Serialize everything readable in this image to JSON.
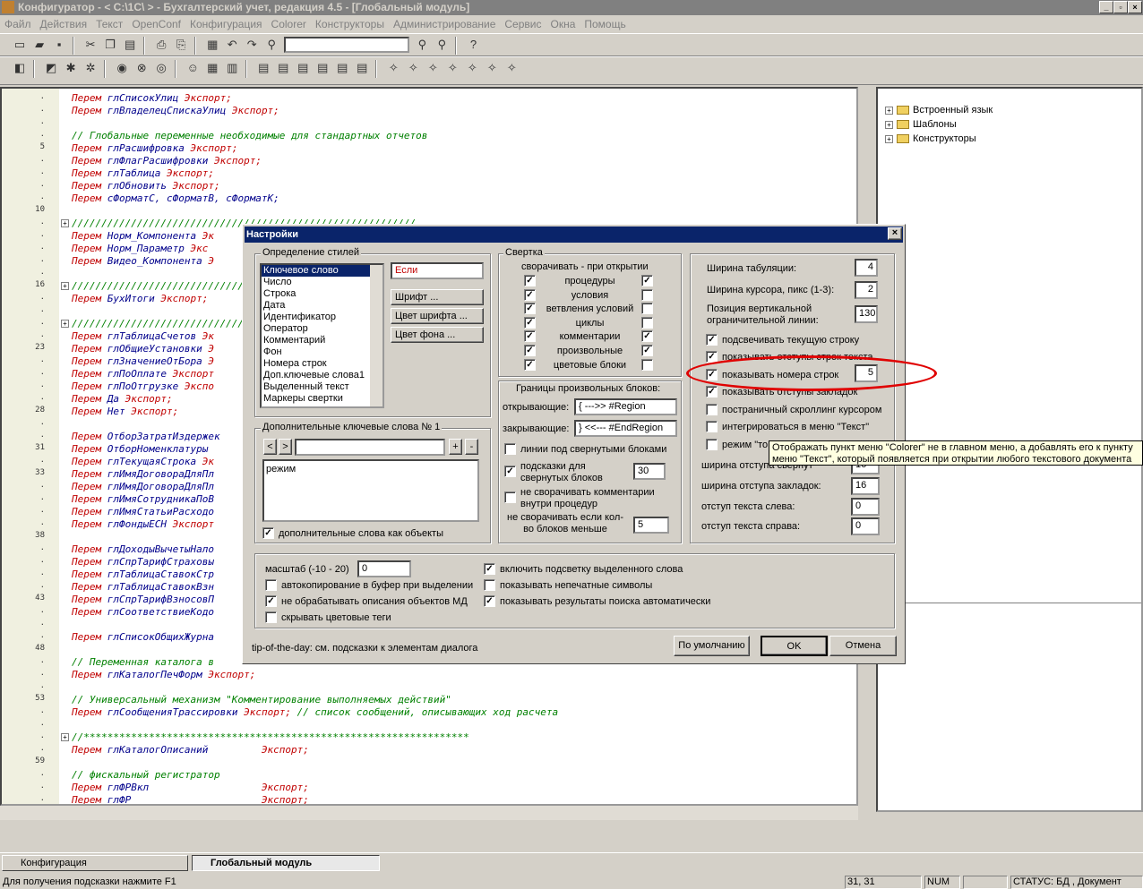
{
  "window": {
    "title": "Конфигуратор - < C:\\1C\\           > - Бухгалтерский учет, редакция 4.5 - [Глобальный модуль]"
  },
  "menu": [
    "Файл",
    "Действия",
    "Текст",
    "OpenConf",
    "Конфигурация",
    "Colorer",
    "Конструкторы",
    "Администрирование",
    "Сервис",
    "Окна",
    "Помощь"
  ],
  "line_numbers": [
    {
      "n": ".",
      "row": 0
    },
    {
      "n": ".",
      "row": 1
    },
    {
      "n": ".",
      "row": 2
    },
    {
      "n": ".",
      "row": 3
    },
    {
      "n": "5",
      "row": 4
    },
    {
      "n": ".",
      "row": 5
    },
    {
      "n": ".",
      "row": 6
    },
    {
      "n": ".",
      "row": 7
    },
    {
      "n": ".",
      "row": 8
    },
    {
      "n": "10",
      "row": 9
    },
    {
      "n": ".",
      "row": 10
    },
    {
      "n": ".",
      "row": 11
    },
    {
      "n": ".",
      "row": 12
    },
    {
      "n": ".",
      "row": 13
    },
    {
      "n": ".",
      "row": 14
    },
    {
      "n": "16",
      "row": 15
    },
    {
      "n": ".",
      "row": 16
    },
    {
      "n": ".",
      "row": 17
    },
    {
      "n": ".",
      "row": 18
    },
    {
      "n": ".",
      "row": 19
    },
    {
      "n": "23",
      "row": 20
    },
    {
      "n": ".",
      "row": 21
    },
    {
      "n": ".",
      "row": 22
    },
    {
      "n": ".",
      "row": 23
    },
    {
      "n": ".",
      "row": 24
    },
    {
      "n": "28",
      "row": 25
    },
    {
      "n": ".",
      "row": 26
    },
    {
      "n": ".",
      "row": 27
    },
    {
      "n": "31",
      "row": 28
    },
    {
      "n": ".",
      "row": 29
    },
    {
      "n": "33",
      "row": 30
    },
    {
      "n": ".",
      "row": 31
    },
    {
      "n": ".",
      "row": 32
    },
    {
      "n": ".",
      "row": 33
    },
    {
      "n": ".",
      "row": 34
    },
    {
      "n": "38",
      "row": 35
    },
    {
      "n": ".",
      "row": 36
    },
    {
      "n": ".",
      "row": 37
    },
    {
      "n": ".",
      "row": 38
    },
    {
      "n": ".",
      "row": 39
    },
    {
      "n": "43",
      "row": 40
    },
    {
      "n": ".",
      "row": 41
    },
    {
      "n": ".",
      "row": 42
    },
    {
      "n": ".",
      "row": 43
    },
    {
      "n": "48",
      "row": 44
    },
    {
      "n": ".",
      "row": 45
    },
    {
      "n": ".",
      "row": 46
    },
    {
      "n": ".",
      "row": 47
    },
    {
      "n": "53",
      "row": 48
    },
    {
      "n": ".",
      "row": 49
    },
    {
      "n": ".",
      "row": 50
    },
    {
      "n": ".",
      "row": 51
    },
    {
      "n": ".",
      "row": 52
    },
    {
      "n": "59",
      "row": 53
    },
    {
      "n": ".",
      "row": 54
    },
    {
      "n": ".",
      "row": 55
    },
    {
      "n": ".",
      "row": 56
    }
  ],
  "code": [
    {
      "row": 0,
      "kw": "Перем",
      "id": " глСписокУлиц",
      "ex": " Экспорт;"
    },
    {
      "row": 1,
      "kw": "Перем",
      "id": " глВладелецСпискаУлиц",
      "ex": " Экспорт;"
    },
    {
      "row": 3,
      "cm": "// Глобальные переменные необходимые для стандартных отчетов"
    },
    {
      "row": 4,
      "kw": "Перем",
      "id": " глРасшифровка",
      "ex": " Экспорт;"
    },
    {
      "row": 5,
      "kw": "Перем",
      "id": " глФлагРасшифровки",
      "ex": " Экспорт;"
    },
    {
      "row": 6,
      "kw": "Перем",
      "id": " глТаблица",
      "ex": " Экспорт;"
    },
    {
      "row": 7,
      "kw": "Перем",
      "id": " глОбновить",
      "ex": " Экспорт;"
    },
    {
      "row": 8,
      "kw": "Перем",
      "id": " сФорматС, сФорматВ, сФорматК;"
    },
    {
      "row": 10,
      "cm": "//////////////////////////////////////////////////////////"
    },
    {
      "row": 11,
      "kw": "Перем",
      "id": " Норм_Компонента",
      "ex": " Эк"
    },
    {
      "row": 12,
      "kw": "Перем",
      "id": " Норм_Параметр",
      "ex": " Экс"
    },
    {
      "row": 13,
      "kw": "Перем",
      "id": " Видео_Компонента",
      "ex": " Э"
    },
    {
      "row": 15,
      "cm": "//////////////////////////////////////////////////////////"
    },
    {
      "row": 16,
      "kw": "Перем",
      "id": " БухИтоги",
      "ex": " Экспорт;"
    },
    {
      "row": 18,
      "cm": "//////////////////////////////////////////////////////////"
    },
    {
      "row": 19,
      "kw": "Перем",
      "id": " глТаблицаСчетов",
      "ex": " Эк"
    },
    {
      "row": 20,
      "kw": "Перем",
      "id": " глОбщиеУстановки",
      "ex": " Э"
    },
    {
      "row": 21,
      "kw": "Перем",
      "id": " глЗначениеОтБора",
      "ex": " Э"
    },
    {
      "row": 22,
      "kw": "Перем",
      "id": " глПоОплате",
      "ex": " Экспорт"
    },
    {
      "row": 23,
      "kw": "Перем",
      "id": " глПоОтгрузке",
      "ex": " Экспо"
    },
    {
      "row": 24,
      "kw": "Перем",
      "id": " Да",
      "ex": " Экспорт;"
    },
    {
      "row": 25,
      "kw": "Перем",
      "id": " Нет",
      "ex": " Экспорт;"
    },
    {
      "row": 27,
      "kw": "Перем",
      "id": " ОтборЗатратИздержек"
    },
    {
      "row": 28,
      "kw": "Перем",
      "id": " ОтборНоменклатуры"
    },
    {
      "row": 29,
      "kw": "Перем",
      "id": " глТекущаяСтрока",
      "ex": " Эк"
    },
    {
      "row": 30,
      "kw": "Перем",
      "id": " глИмяДоговораДляПл"
    },
    {
      "row": 31,
      "kw": "Перем",
      "id": " глИмяДоговораДляПл"
    },
    {
      "row": 32,
      "kw": "Перем",
      "id": " глИмяСотрудникаПоВ"
    },
    {
      "row": 33,
      "kw": "Перем",
      "id": " глИмяСтатьиРасходо"
    },
    {
      "row": 34,
      "kw": "Перем",
      "id": " глФондыЕСН",
      "ex": " Экспорт"
    },
    {
      "row": 36,
      "kw": "Перем",
      "id": " глДоходыВычетыНало"
    },
    {
      "row": 37,
      "kw": "Перем",
      "id": " глСпрТарифСтраховы"
    },
    {
      "row": 38,
      "kw": "Перем",
      "id": " глТаблицаСтавокСтр"
    },
    {
      "row": 39,
      "kw": "Перем",
      "id": " глТаблицаСтавокВзн"
    },
    {
      "row": 40,
      "kw": "Перем",
      "id": " глСпрТарифВзносовП"
    },
    {
      "row": 41,
      "kw": "Перем",
      "id": " глСоответствиеКодо"
    },
    {
      "row": 43,
      "kw": "Перем",
      "id": " глСписокОбщихЖурна"
    },
    {
      "row": 45,
      "cm": "// Переменная каталога в"
    },
    {
      "row": 46,
      "kw": "Перем",
      "id": " глКаталогПечФорм",
      "ex": " Экспорт;"
    },
    {
      "row": 48,
      "cm": "// Универсальный механизм \"Комментирование выполняемых действий\""
    },
    {
      "row": 49,
      "kw": "Перем",
      "id": " глСообщенияТрассировки",
      "ex": " Экспорт;",
      "cm2": " // список сообщений, описывающих ход расчета"
    },
    {
      "row": 51,
      "cm": "//*****************************************************************"
    },
    {
      "row": 52,
      "kw": "Перем",
      "id": " глКаталогОписаний         ",
      "ex": "Экспорт;"
    },
    {
      "row": 54,
      "cm": "// фискальный регистратор"
    },
    {
      "row": 55,
      "kw": "Перем",
      "id": " глФРВкл                   ",
      "ex": "Экспорт;"
    },
    {
      "row": 56,
      "kw": "Перем",
      "id": " глФР                      ",
      "ex": "Экспорт;"
    }
  ],
  "tree": [
    "Встроенный язык",
    "Шаблоны",
    "Конструкторы"
  ],
  "dialog": {
    "title": "Настройки",
    "styles_group": "Определение стилей",
    "styles_list": [
      "Ключевое слово",
      "Число",
      "Строка",
      "Дата",
      "Идентификатор",
      "Оператор",
      "Комментарий",
      "Фон",
      "Номера строк",
      "Доп.ключевые слова1",
      "Выделенный текст",
      "Маркеры свертки"
    ],
    "sample_text": "Если",
    "font_btn": "Шрифт ...",
    "fontcolor_btn": "Цвет шрифта ...",
    "bgcolor_btn": "Цвет фона ...",
    "extra_group": "Дополнительные ключевые слова № 1",
    "extra_nav_prev": "<",
    "extra_nav_next": ">",
    "extra_add": "+",
    "extra_remove": "-",
    "extra_list": [
      "режим"
    ],
    "extra_as_objects": "дополнительные слова как объекты",
    "fold_group": "Свертка",
    "fold_header": "сворачивать  -  при открытии",
    "fold_items": [
      {
        "label": "процедуры",
        "a": true,
        "b": true
      },
      {
        "label": "условия",
        "a": true,
        "b": false
      },
      {
        "label": "ветвления условий",
        "a": true,
        "b": false
      },
      {
        "label": "циклы",
        "a": true,
        "b": false
      },
      {
        "label": "комментарии",
        "a": true,
        "b": true
      },
      {
        "label": "произвольные",
        "a": true,
        "b": true
      },
      {
        "label": "цветовые блоки",
        "a": true,
        "b": false
      }
    ],
    "bounds_title": "Границы произвольных блоков:",
    "open_label": "открывающие:",
    "open_value": "{ --->> #Region",
    "close_label": "закрывающие:",
    "close_value": "} <<--- #EndRegion",
    "lines_under": "линии под свернутыми блоками",
    "hints_folded": "подсказки для свернутых блоков",
    "hints_value": "30",
    "no_fold_comments": "не сворачивать комментарии внутри процедур",
    "no_fold_if": "не сворачивать если кол-во блоков меньше",
    "no_fold_value": "5",
    "tab_width_label": "Ширина табуляции:",
    "tab_width": "4",
    "cursor_width_label": "Ширина курсора, пикс (1-3):",
    "cursor_width": "2",
    "vline_label": "Позиция вертикальной ограничительной линии:",
    "vline": "130",
    "right_checks": [
      {
        "label": "подсвечивать текущую строку",
        "checked": true
      },
      {
        "label": "показывать отступы строк текста",
        "checked": true
      },
      {
        "label": "показывать номера строк",
        "checked": true
      },
      {
        "label": "показывать отступы закладок",
        "checked": true
      },
      {
        "label": "постраничный скроллинг курсором",
        "checked": false
      },
      {
        "label": "интегрироваться в меню \"Текст\"",
        "checked": false
      },
      {
        "label": "режим \"то",
        "checked": false
      }
    ],
    "line_numbers_value": "5",
    "indent_width_label": "ширина отступа свернут",
    "indent_width": "16",
    "bookmark_width_label": "ширина отступа закладок:",
    "bookmark_width": "16",
    "left_indent_label": "отступ текста слева:",
    "left_indent": "0",
    "right_indent_label": "отступ текста справа:",
    "right_indent": "0",
    "scale_label": "масштаб (-10 - 20)",
    "scale": "0",
    "bottom_checks_left": [
      {
        "label": "автокопирование в буфер при выделении",
        "checked": false
      },
      {
        "label": "не обрабатывать описания объектов МД",
        "checked": true
      },
      {
        "label": "скрывать цветовые теги",
        "checked": false
      }
    ],
    "bottom_checks_right": [
      {
        "label": "включить подсветку выделенного слова",
        "checked": true
      },
      {
        "label": "показывать непечатные символы",
        "checked": false
      },
      {
        "label": "показывать результаты поиска автоматически",
        "checked": true
      }
    ],
    "tip": "tip-of-the-day: см. подсказки к элементам диалога",
    "default_btn": "По умолчанию",
    "ok_btn": "OK",
    "cancel_btn": "Отмена"
  },
  "tooltip": "Отображать пункт меню \"Colorer\" не в главном меню, а добавлять его к пункту меню \"Текст\", который появляется при открытии любого текстового документа",
  "tasks": [
    "Конфигурация",
    "Глобальный модуль"
  ],
  "status": {
    "hint": "Для получения подсказки нажмите F1",
    "pos": "31, 31",
    "num": "NUM",
    "state": "СТАТУС: БД , Документ"
  }
}
